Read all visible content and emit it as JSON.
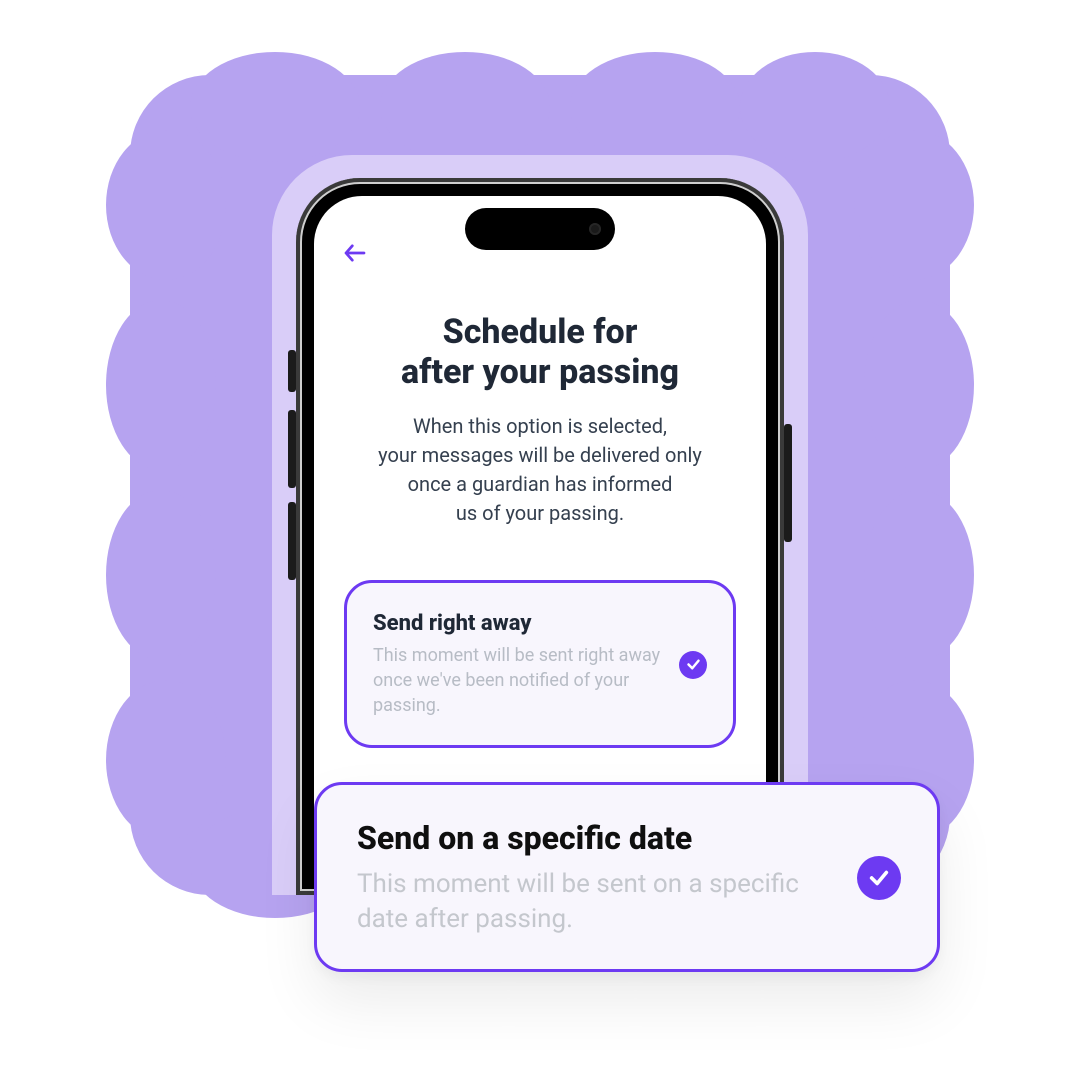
{
  "colors": {
    "accent": "#6d3af2",
    "lavender": "#b6a3f0"
  },
  "icons": {
    "back": "arrow-left-icon",
    "check": "check-icon"
  },
  "screen": {
    "title_line1": "Schedule for",
    "title_line2": "after your passing",
    "sub_line1": "When this option is selected,",
    "sub_line2": "your messages will be delivered only",
    "sub_line3": "once a guardian has informed",
    "sub_line4": "us of your passing."
  },
  "options": [
    {
      "title": "Send right away",
      "desc": "This moment will be sent right away once we've been notified of your passing.",
      "selected": true
    },
    {
      "title": "Send on a specific date",
      "desc": "This moment will be sent on a specific date after passing.",
      "selected": true
    }
  ]
}
